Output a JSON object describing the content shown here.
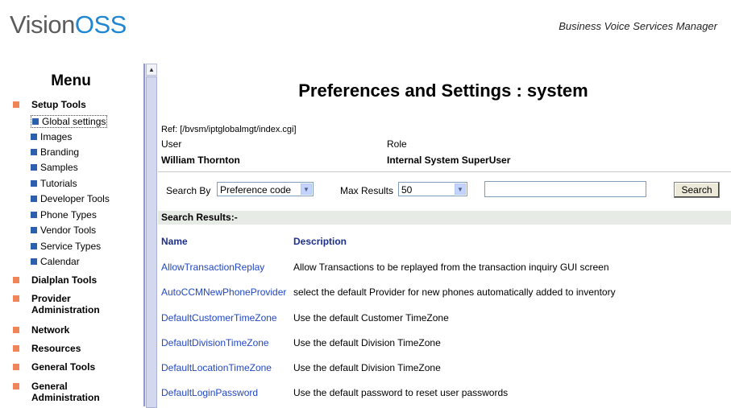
{
  "header": {
    "logo_part1": "Vision",
    "logo_part2": "OSS",
    "subtitle": "Business Voice Services Manager"
  },
  "sidebar": {
    "title": "Menu",
    "sections": [
      {
        "label": "Setup Tools"
      },
      {
        "label": "Dialplan Tools"
      },
      {
        "label": "Provider Administration"
      },
      {
        "label": "Network"
      },
      {
        "label": "Resources"
      },
      {
        "label": "General Tools"
      },
      {
        "label": "General Administration"
      }
    ],
    "setup_items": [
      {
        "label": "Global settings"
      },
      {
        "label": "Images"
      },
      {
        "label": "Branding"
      },
      {
        "label": "Samples"
      },
      {
        "label": "Tutorials"
      },
      {
        "label": "Developer Tools"
      },
      {
        "label": "Phone Types"
      },
      {
        "label": "Vendor Tools"
      },
      {
        "label": "Service Types"
      },
      {
        "label": "Calendar"
      }
    ]
  },
  "main": {
    "title": "Preferences and Settings : system",
    "ref": "Ref: [/bvsm/iptglobalmgt/index.cgi]",
    "user_label": "User",
    "user_value": "William Thornton",
    "role_label": "Role",
    "role_value": "Internal System SuperUser"
  },
  "search": {
    "by_label": "Search By",
    "by_value": "Preference code",
    "max_label": "Max Results",
    "max_value": "50",
    "text_value": "",
    "button_label": "Search"
  },
  "results": {
    "header": "Search Results:-",
    "col_name": "Name",
    "col_desc": "Description",
    "rows": [
      {
        "name": "AllowTransactionReplay",
        "description": "Allow Transactions to be replayed from the transaction inquiry GUI screen"
      },
      {
        "name": "AutoCCMNewPhoneProvider",
        "description": "select the default Provider for new phones automatically added to inventory"
      },
      {
        "name": "DefaultCustomerTimeZone",
        "description": "Use the default Customer TimeZone"
      },
      {
        "name": "DefaultDivisionTimeZone",
        "description": "Use the default Division TimeZone"
      },
      {
        "name": "DefaultLocationTimeZone",
        "description": "Use the default Division TimeZone"
      },
      {
        "name": "DefaultLoginPassword",
        "description": "Use the default password to reset user passwords"
      }
    ]
  }
}
